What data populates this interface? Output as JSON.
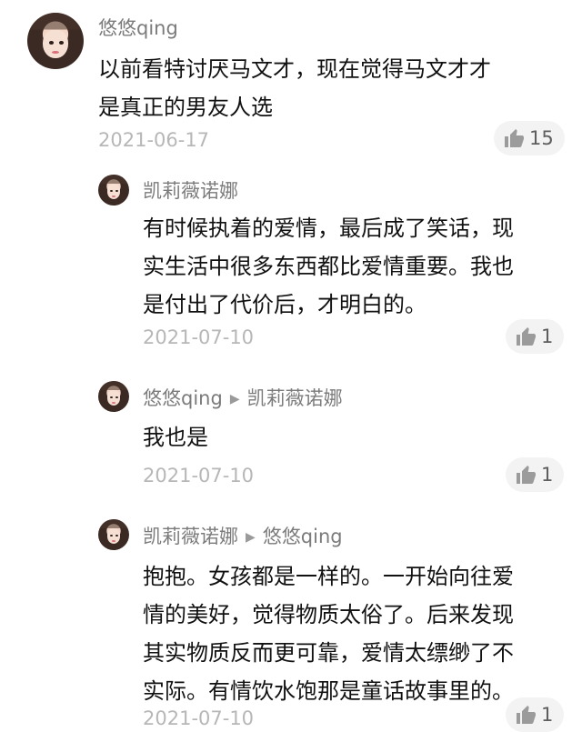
{
  "comments": [
    {
      "user": "悠悠qing",
      "lines": [
        "以前看特讨厌马文才，现在觉得马文才才",
        "是真正的男友人选"
      ],
      "date": "2021-06-17",
      "likes": "15"
    },
    {
      "user": "凯莉薇诺娜",
      "lines": [
        "有时候执着的爱情，最后成了笑话，现",
        "实生活中很多东西都比爱情重要。我也",
        "是付出了代价后，才明白的。"
      ],
      "date": "2021-07-10",
      "likes": "1"
    },
    {
      "user": "悠悠qing",
      "reply_arrow": "▶",
      "reply_to": "凯莉薇诺娜",
      "lines": [
        "我也是"
      ],
      "date": "2021-07-10",
      "likes": "1"
    },
    {
      "user": "凯莉薇诺娜",
      "reply_arrow": "▶",
      "reply_to": "悠悠qing",
      "lines": [
        "抱抱。女孩都是一样的。一开始向往爱",
        "情的美好，觉得物质太俗了。后来发现",
        "其实物质反而更可靠，爱情太缥缈了不",
        "实际。有情饮水饱那是童话故事里的。"
      ],
      "date": "2021-07-10",
      "likes": "1"
    }
  ],
  "icons": {
    "like": "thumbs-up-icon",
    "reply": "triangle-right-icon"
  },
  "colors": {
    "username": "#7b7b7b",
    "text": "#111111",
    "date": "#b7b7b7",
    "like_bg": "#f3f3f3"
  }
}
